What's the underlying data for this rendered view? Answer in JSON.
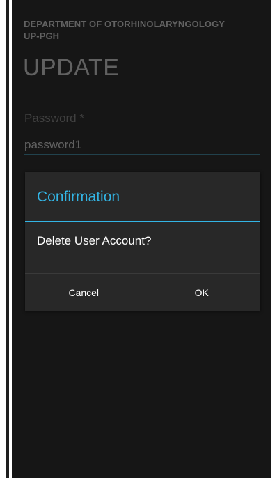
{
  "background": {
    "department_line1": "DEPARTMENT OF OTORHINOLARYNGOLOGY",
    "department_line2": "UP-PGH",
    "page_title": "UPDATE",
    "password_label": "Password *",
    "password_value": "password1"
  },
  "dialog": {
    "title": "Confirmation",
    "message": "Delete User Account?",
    "cancel_label": "Cancel",
    "ok_label": "OK"
  },
  "colors": {
    "screen_background": "#161616",
    "dialog_background": "#282828",
    "accent": "#33b5e5",
    "text": "#ffffff"
  }
}
